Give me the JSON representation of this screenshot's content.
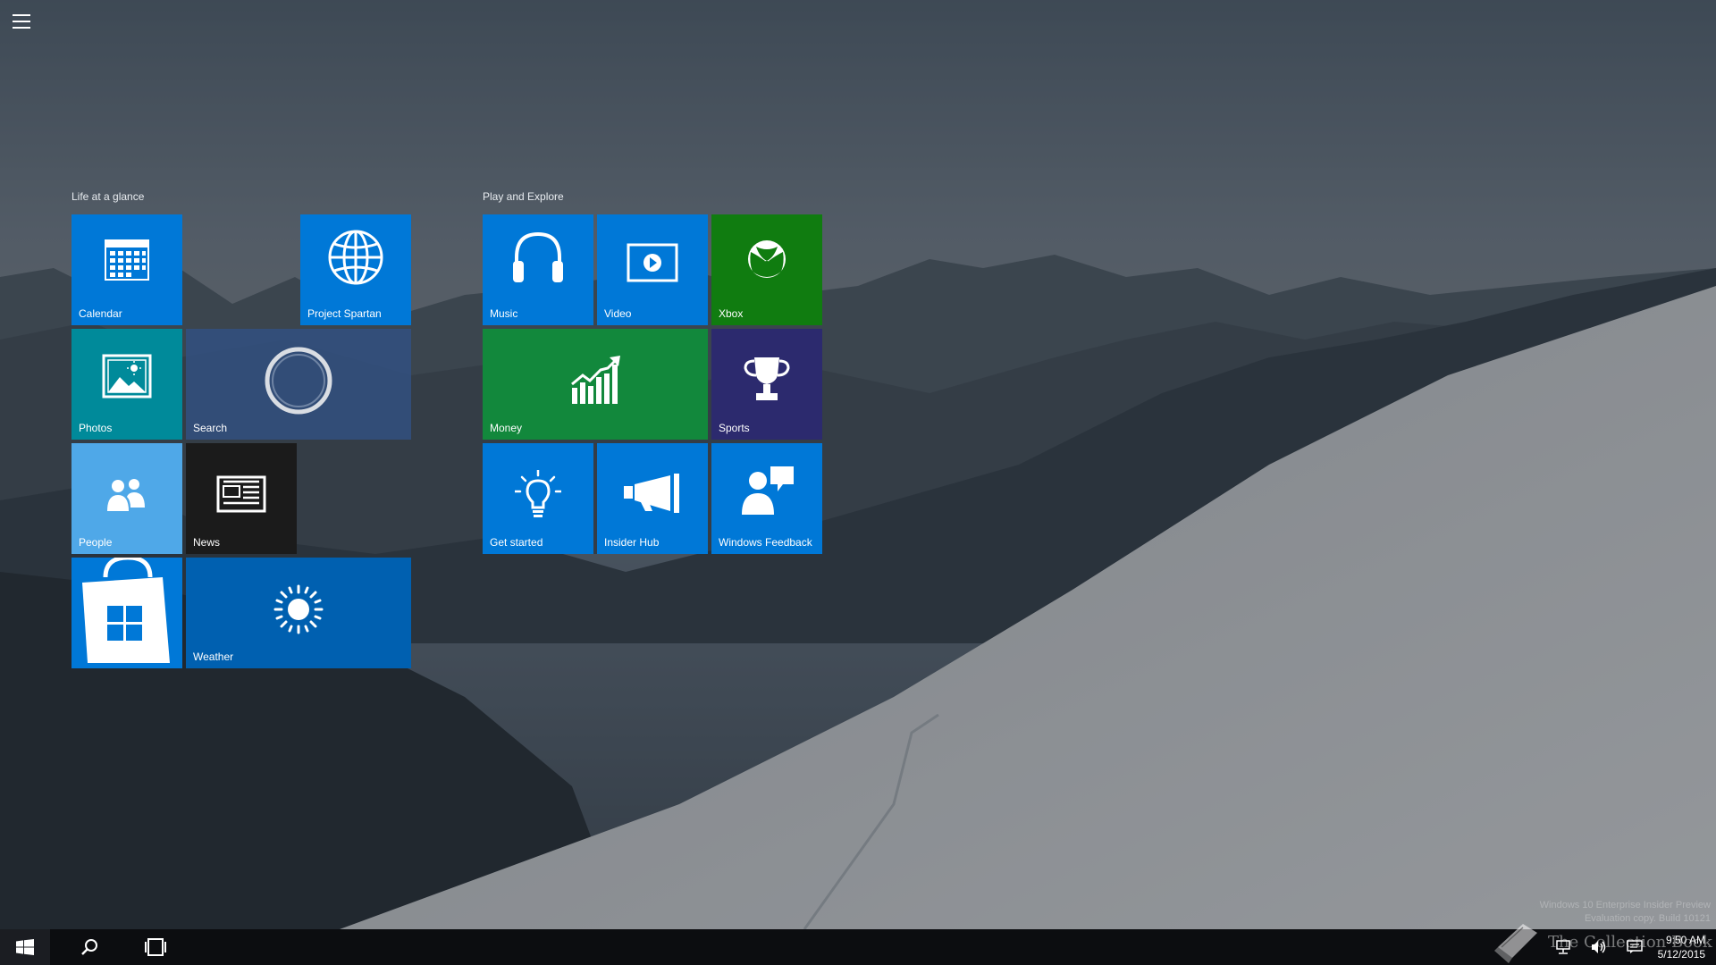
{
  "groups": [
    {
      "title": "Life at a glance"
    },
    {
      "title": "Play and Explore"
    }
  ],
  "tiles": {
    "calendar": {
      "label": "Calendar",
      "color": "#0078d7",
      "icon": "calendar-icon"
    },
    "spartan": {
      "label": "Project Spartan",
      "color": "#0078d7",
      "icon": "globe-icon"
    },
    "photos": {
      "label": "Photos",
      "color": "#008a9a",
      "icon": "photo-icon"
    },
    "search": {
      "label": "Search",
      "color": "#2e4f80",
      "icon": "cortana-circle-icon"
    },
    "people": {
      "label": "People",
      "color": "#4fa8e8",
      "icon": "people-icon"
    },
    "news": {
      "label": "News",
      "color": "#1b1b1b",
      "icon": "newspaper-icon"
    },
    "store": {
      "label": "",
      "color": "#0078d7",
      "icon": "store-bag-icon"
    },
    "weather": {
      "label": "Weather",
      "color": "#0060b0",
      "icon": "sun-icon"
    },
    "music": {
      "label": "Music",
      "color": "#0078d7",
      "icon": "headphones-icon"
    },
    "video": {
      "label": "Video",
      "color": "#0078d7",
      "icon": "video-play-icon"
    },
    "xbox": {
      "label": "Xbox",
      "color": "#107c10",
      "icon": "xbox-icon"
    },
    "money": {
      "label": "Money",
      "color": "#12883c",
      "icon": "chart-up-icon"
    },
    "sports": {
      "label": "Sports",
      "color": "#2c2a6e",
      "icon": "trophy-icon"
    },
    "getstarted": {
      "label": "Get started",
      "color": "#0078d7",
      "icon": "lightbulb-icon"
    },
    "insiderhub": {
      "label": "Insider Hub",
      "color": "#0078d7",
      "icon": "megaphone-icon"
    },
    "feedback": {
      "label": "Windows Feedback",
      "color": "#0078d7",
      "icon": "feedback-person-icon"
    }
  },
  "taskbar": {
    "clock_time": "9:50 AM",
    "clock_date": "5/12/2015"
  },
  "watermark": {
    "line1": "Windows 10 Enterprise Insider Preview",
    "line2": "Evaluation copy. Build 10121"
  },
  "overlay": {
    "brand_text": "The Collection Book"
  }
}
